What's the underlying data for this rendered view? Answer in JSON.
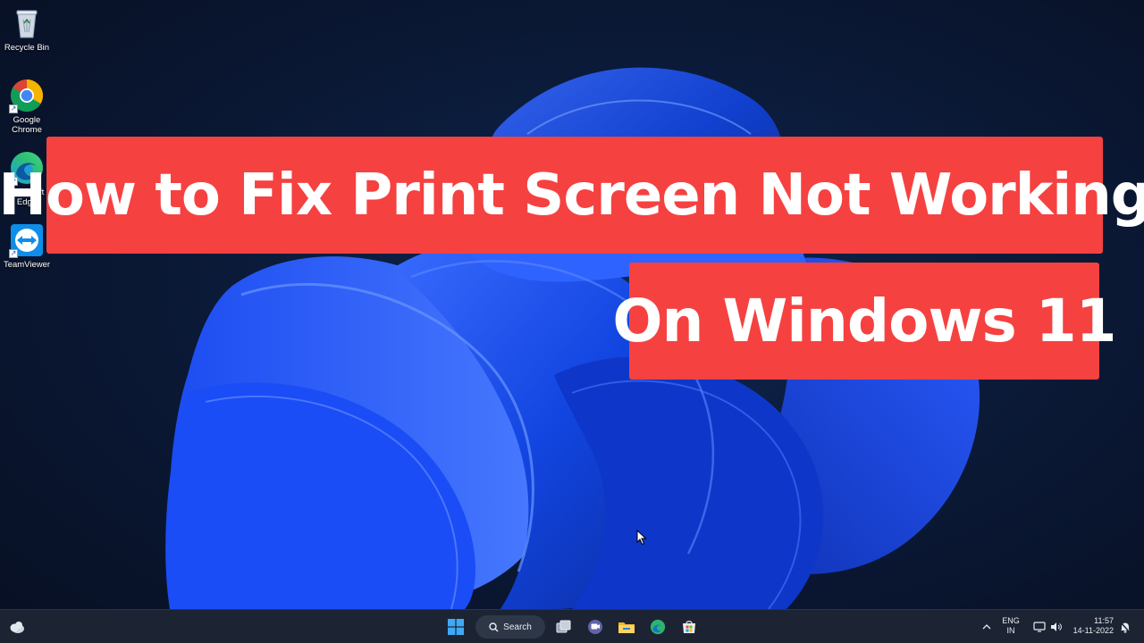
{
  "desktop_icons": [
    {
      "name": "recycle-bin",
      "label": "Recycle Bin",
      "shortcut": false
    },
    {
      "name": "google-chrome",
      "label": "Google Chrome",
      "shortcut": true
    },
    {
      "name": "microsoft-edge",
      "label": "Microsoft Edge",
      "shortcut": true
    },
    {
      "name": "teamviewer",
      "label": "TeamViewer",
      "shortcut": true
    }
  ],
  "banner": {
    "line1": "How to Fix Print Screen Not Working",
    "line2": "On Windows 11",
    "color": "#f64141"
  },
  "taskbar": {
    "search_label": "Search",
    "pinned": [
      "start-icon",
      "search-icon",
      "task-view-icon",
      "teams-chat-icon",
      "file-explorer-icon",
      "edge-icon",
      "store-icon"
    ],
    "weather_icon": "weather-cloud-icon"
  },
  "tray": {
    "lang_line1": "ENG",
    "lang_line2": "IN",
    "time": "11:57",
    "date": "14-11-2022"
  },
  "colors": {
    "taskbar_bg": "#1c2433",
    "accent": "#1a5cff"
  }
}
